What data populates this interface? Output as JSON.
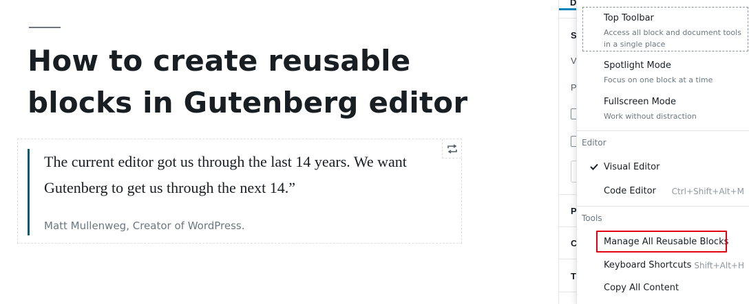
{
  "post": {
    "title": "How to create reusable blocks in Gutenberg editor",
    "quote_text": "The current editor got us through the last 14 years. We want Gutenberg to get us through the next 14.”",
    "quote_citation": "Matt Mullenweg, Creator of WordPress."
  },
  "sidebar": {
    "tab_letter": "D",
    "letters": [
      "S",
      "V",
      "P",
      "P",
      "C",
      "T"
    ]
  },
  "menu": {
    "view": [
      {
        "label": "Top Toolbar",
        "description": "Access all block and document tools in a single place"
      },
      {
        "label": "Spotlight Mode",
        "description": "Focus on one block at a time"
      },
      {
        "label": "Fullscreen Mode",
        "description": "Work without distraction"
      }
    ],
    "editor_group_label": "Editor",
    "editor": [
      {
        "label": "Visual Editor",
        "shortcut": "",
        "checked": true
      },
      {
        "label": "Code Editor",
        "shortcut": "Ctrl+Shift+Alt+M",
        "checked": false
      }
    ],
    "tools_group_label": "Tools",
    "tools": [
      {
        "label": "Manage All Reusable Blocks",
        "shortcut": ""
      },
      {
        "label": "Keyboard Shortcuts",
        "shortcut": "Shift+Alt+H"
      },
      {
        "label": "Copy All Content",
        "shortcut": ""
      }
    ]
  },
  "colors": {
    "accent": "#0085ba",
    "quote_border": "#0e5a72",
    "highlight": "#e3000f"
  },
  "icons": {
    "transform": "block-transform-icon",
    "check": "check-icon"
  }
}
